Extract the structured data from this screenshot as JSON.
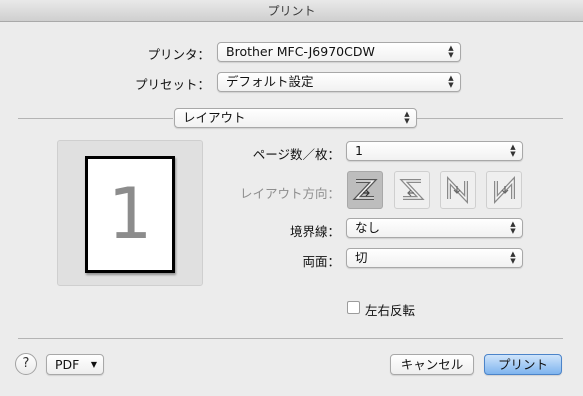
{
  "window": {
    "title": "プリント"
  },
  "printer": {
    "label": "プリンタ：",
    "value": "Brother MFC-J6970CDW"
  },
  "preset": {
    "label": "プリセット：",
    "value": "デフォルト設定"
  },
  "section": {
    "value": "レイアウト"
  },
  "preview": {
    "page_number": "1"
  },
  "pages_per_sheet": {
    "label": "ページ数／枚：",
    "value": "1"
  },
  "layout_direction": {
    "label": "レイアウト方向："
  },
  "border": {
    "label": "境界線：",
    "value": "なし"
  },
  "two_sided": {
    "label": "両面：",
    "value": "切"
  },
  "flip": {
    "label": "左右反転",
    "checked": false
  },
  "footer": {
    "help": "?",
    "pdf_label": "PDF",
    "cancel_label": "キャンセル",
    "print_label": "プリント"
  },
  "colors": {
    "accent": "#7fb4ee",
    "background": "#ececec"
  }
}
